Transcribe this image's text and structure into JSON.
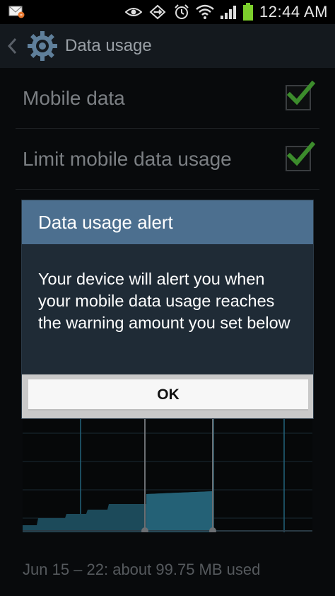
{
  "status_bar": {
    "time": "12:44 AM",
    "icons": [
      "email-notification-icon",
      "eye-icon",
      "sync-icon",
      "alarm-icon",
      "wifi-icon",
      "signal-icon",
      "battery-icon"
    ]
  },
  "action_bar": {
    "title": "Data usage",
    "icons": [
      "back-chevron-icon",
      "gear-icon"
    ]
  },
  "settings": {
    "mobile_data": {
      "label": "Mobile data",
      "checked": true
    },
    "limit_mobile_data": {
      "label": "Limit mobile data usage",
      "checked": true
    },
    "usage_summary": "Jun 15 – 22: about 99.75 MB used"
  },
  "dialog": {
    "title": "Data usage alert",
    "message": "Your device will alert you when your mobile data usage reaches the warning amount you set below",
    "ok_label": "OK"
  },
  "colors": {
    "dialog_title_bg": "#4c6f8f",
    "dialog_body_bg": "#1f2b36",
    "check_green": "#3c8c2c",
    "graph_fill": "#1c4a5a"
  }
}
